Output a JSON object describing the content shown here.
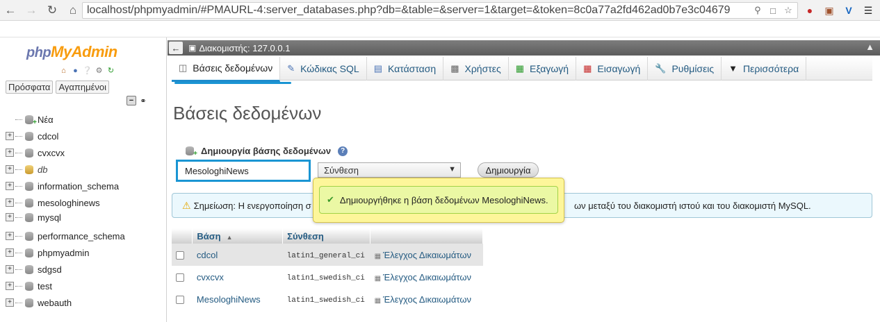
{
  "browser": {
    "url": "localhost/phpmyadmin/#PMAURL-4:server_databases.php?db=&table=&server=1&target=&token=8c0a77a2fd462ad0b7e3c04679",
    "back_icon": "back-arrow-icon",
    "forward_icon": "forward-arrow-icon",
    "reload_icon": "reload-icon",
    "home_icon": "home-icon"
  },
  "nav": {
    "logo_php": "php",
    "logo_myadmin": "MyAdmin",
    "tab_recent": "Πρόσφατα",
    "tab_favorites": "Αγαπημένοι",
    "databases": [
      {
        "name": "Νέα",
        "kind": "new"
      },
      {
        "name": "cdcol",
        "kind": "db"
      },
      {
        "name": "cvxcvx",
        "kind": "db"
      },
      {
        "name": "db",
        "kind": "special"
      },
      {
        "name": "information_schema",
        "kind": "db"
      },
      {
        "name": "mesologhinews",
        "kind": "db"
      },
      {
        "name": "mysql",
        "kind": "db"
      },
      {
        "name": "performance_schema",
        "kind": "db"
      },
      {
        "name": "phpmyadmin",
        "kind": "db"
      },
      {
        "name": "sdgsd",
        "kind": "db"
      },
      {
        "name": "test",
        "kind": "db"
      },
      {
        "name": "webauth",
        "kind": "db"
      }
    ]
  },
  "server_bar": {
    "label": "Διακομιστής: 127.0.0.1"
  },
  "tabs": [
    {
      "label": "Βάσεις δεδομένων",
      "icon": "database-icon",
      "active": true
    },
    {
      "label": "Κώδικας SQL",
      "icon": "sql-icon"
    },
    {
      "label": "Κατάσταση",
      "icon": "status-icon"
    },
    {
      "label": "Χρήστες",
      "icon": "users-icon"
    },
    {
      "label": "Εξαγωγή",
      "icon": "export-icon"
    },
    {
      "label": "Εισαγωγή",
      "icon": "import-icon"
    },
    {
      "label": "Ρυθμίσεις",
      "icon": "settings-icon"
    },
    {
      "label": "Περισσότερα",
      "icon": "more-icon"
    }
  ],
  "page": {
    "title": "Βάσεις δεδομένων",
    "create_label": "Δημιουργία βάσης δεδομένων",
    "db_name_value": "MesologhiNews",
    "collation_selected": "Σύνθεση",
    "create_button": "Δημιουργία",
    "notice_left": "Σημείωση: Η ενεργοποίηση σ",
    "notice_right": "ων μεταξύ του διακομιστή ιστού και του διακομιστή MySQL.",
    "success_message": "Δημιουργήθηκε η βάση δεδομένων MesologhiNews."
  },
  "table": {
    "headers": {
      "name": "Βάση",
      "collation": "Σύνθεση"
    },
    "rows": [
      {
        "name": "cdcol",
        "collation": "latin1_general_ci",
        "action": "Έλεγχος Δικαιωμάτων"
      },
      {
        "name": "cvxcvx",
        "collation": "latin1_swedish_ci",
        "action": "Έλεγχος Δικαιωμάτων"
      },
      {
        "name": "MesologhiNews",
        "collation": "latin1_swedish_ci",
        "action": "Έλεγχος Δικαιωμάτων"
      }
    ]
  },
  "colors": {
    "accent": "#1a95d3",
    "link": "#235a81",
    "logo_php": "#6c78af",
    "logo_myadmin": "#f89c0e",
    "success_bg": "#ebf8a4",
    "notice_bg": "#ebf8fd"
  }
}
